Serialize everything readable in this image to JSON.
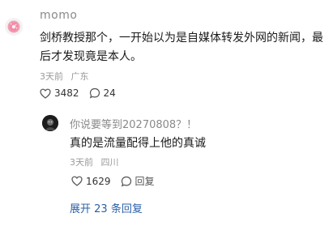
{
  "comment": {
    "username": "momo",
    "text": "剑桥教授那个，一开始以为是自媒体转发外网的新闻，最后才发现竟是本人。",
    "time": "3天前",
    "location": "广东",
    "likes": "3482",
    "comments": "24"
  },
  "reply": {
    "username": "你说要等到20270808？！",
    "text": "真的是流量配得上他的真诚",
    "time": "3天前",
    "location": "四川",
    "likes": "1629",
    "reply_label": "回复"
  },
  "expand": {
    "prefix": "展开",
    "count": "23",
    "suffix": "条回复"
  },
  "icons": {
    "main_avatar": "donut-avatar",
    "reply_avatar": "dark-avatar",
    "like": "heart-icon",
    "comment": "comment-icon"
  }
}
